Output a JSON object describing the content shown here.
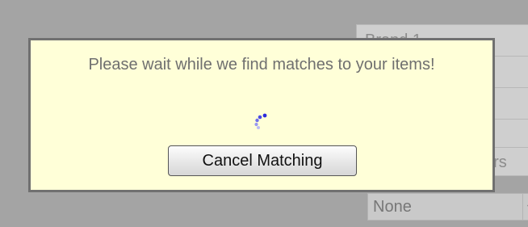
{
  "background_form": {
    "field1_value": "Brand 1",
    "field5_partial_text": "ers",
    "select_value": "None"
  },
  "dialog": {
    "message": "Please wait while we find matches to your items!",
    "cancel_label": "Cancel Matching",
    "spinner_icon": "loading-spinner-icon",
    "background_color": "#ffffd8"
  }
}
